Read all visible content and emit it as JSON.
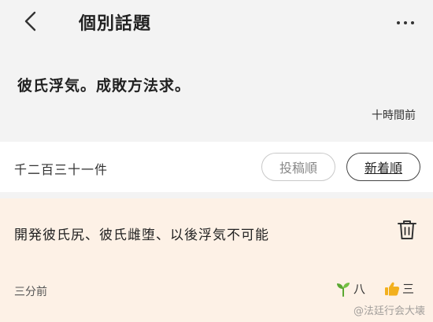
{
  "header": {
    "title": "個別話題",
    "back_icon": "chevron-left-icon",
    "more_icon": "more-horizontal-icon"
  },
  "topic": {
    "title": "彼氏浮気。成敗方法求。",
    "time": "十時間前"
  },
  "sort_bar": {
    "count": "千二百三十一件",
    "options": [
      "投稿順",
      "新着順"
    ],
    "selected": "新着順"
  },
  "comment": {
    "text": "開発彼氏尻、彼氏雌堕、以後浮気不可能",
    "time": "三分前",
    "sprout_count": "八",
    "like_count": "三",
    "delete_icon": "trash-icon"
  },
  "watermark": "@法廷行会大壊",
  "colors": {
    "background": "#f3f3f3",
    "comment_bg": "#fdf1e6",
    "sprout_green": "#5aa832",
    "like_yellow": "#f2b01e"
  }
}
